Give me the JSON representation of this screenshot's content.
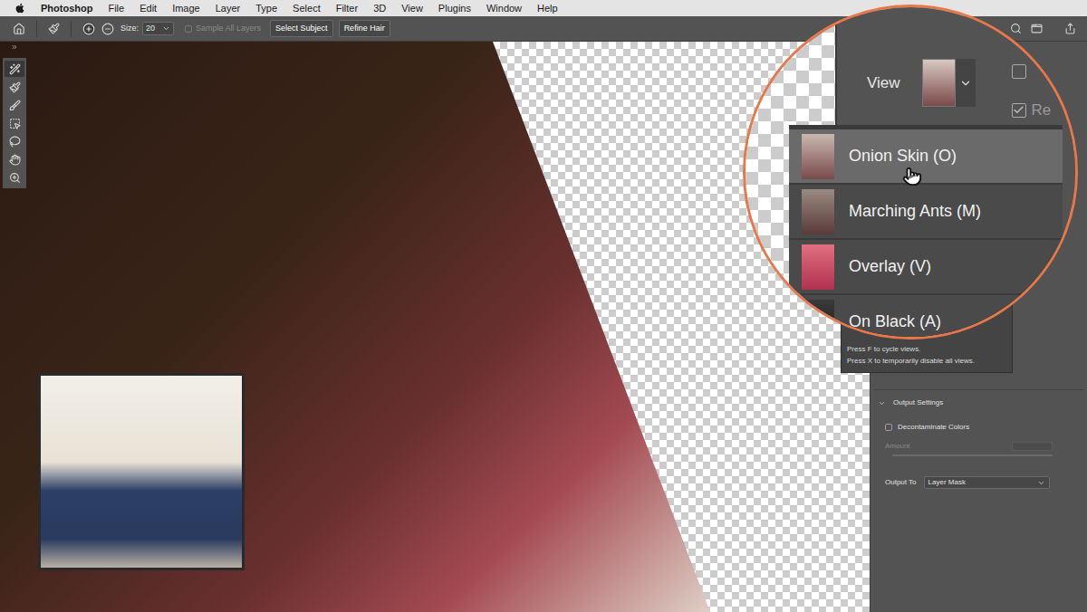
{
  "menu_bar": {
    "app": "Photoshop",
    "items": [
      "File",
      "Edit",
      "Image",
      "Layer",
      "Type",
      "Select",
      "Filter",
      "3D",
      "View",
      "Plugins",
      "Window",
      "Help"
    ]
  },
  "options_bar": {
    "size_label": "Size:",
    "size_value": "20",
    "sample_all_layers": {
      "label": "Sample All Layers",
      "checked": false,
      "disabled": true
    },
    "buttons": [
      "Select Subject",
      "Refine Hair"
    ]
  },
  "tools": [
    {
      "selected": true
    },
    {
      "selected": false
    },
    {
      "selected": false
    },
    {
      "selected": false
    },
    {
      "selected": false
    },
    {
      "selected": false
    },
    {
      "selected": false
    }
  ],
  "magnifier": {
    "view_label": "View",
    "show_edge": {
      "checked": false
    },
    "remember": {
      "label": "Re",
      "checked": true
    },
    "view_options": [
      {
        "label": "Onion Skin (O)",
        "selected": true
      },
      {
        "label": "Marching Ants (M)",
        "selected": false
      },
      {
        "label": "Overlay (V)",
        "selected": false
      },
      {
        "label": "On Black (A)",
        "selected": false
      }
    ]
  },
  "view_menu_help": [
    "Press F to cycle views.",
    "Press X to temporarily disable all views."
  ],
  "output_settings": {
    "title": "Output Settings",
    "expanded": true,
    "decontaminate": {
      "label": "Decontaminate Colors",
      "checked": false
    },
    "amount": {
      "label": "Amount",
      "disabled": true
    },
    "output_to": {
      "label": "Output To",
      "value": "Layer Mask"
    }
  }
}
